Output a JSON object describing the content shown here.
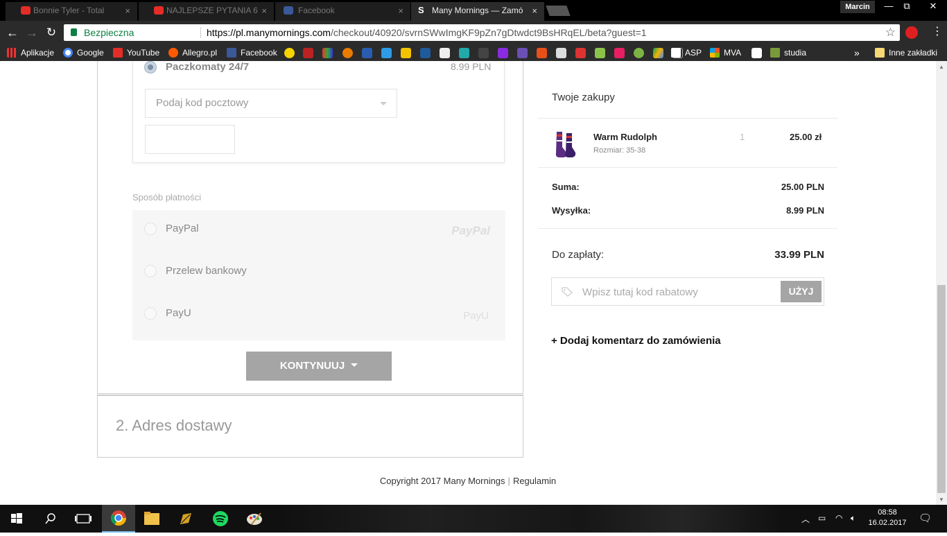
{
  "browser": {
    "tabs": [
      {
        "title": "Bonnie Tyler - Total",
        "close": "×"
      },
      {
        "title": "NAJLEPSZE PYTANIA 6",
        "close": "×"
      },
      {
        "title": "Facebook",
        "close": "×"
      },
      {
        "title": "Many Mornings — Zamó",
        "close": "×"
      }
    ],
    "user": "Marcin",
    "window_controls": {
      "minimize": "—",
      "restore": "⧉",
      "close": "✕"
    },
    "secure_label": "Bezpieczna",
    "url_host": "https://pl.manymornings.com",
    "url_path": "/checkout/40920/svrnSWwImgKF9pZn7gDtwdct9BsHRqEL/beta?guest=1",
    "bookmarks": [
      {
        "label": "Aplikacje",
        "icon": "apps-grid-icon"
      },
      {
        "label": "Google",
        "icon": "google-icon"
      },
      {
        "label": "YouTube",
        "icon": "youtube-icon"
      },
      {
        "label": "Allegro.pl",
        "icon": "allegro-icon"
      },
      {
        "label": "Facebook",
        "icon": "facebook-icon"
      },
      {
        "label": "ASP",
        "icon": "page-icon"
      },
      {
        "label": "MVA",
        "icon": "microsoft-icon"
      },
      {
        "label": "studia",
        "icon": "studia-icon"
      }
    ],
    "bookmarks_overflow": "»",
    "other_bookmarks": "Inne zakładki"
  },
  "shipping": {
    "option_label": "Paczkomaty 24/7",
    "option_price": "8.99 PLN",
    "postcode_placeholder": "Podaj kod pocztowy"
  },
  "payment": {
    "section_label": "Sposób płatności",
    "methods": [
      {
        "label": "PayPal",
        "logo": "PayPal"
      },
      {
        "label": "Przelew bankowy",
        "logo": ""
      },
      {
        "label": "PayU",
        "logo": "PayU"
      }
    ],
    "continue_label": "KONTYNUUJ"
  },
  "address": {
    "number": "2.",
    "title": "Adres dostawy"
  },
  "cart": {
    "title": "Twoje zakupy",
    "items": [
      {
        "name": "Warm Rudolph",
        "size": "Rozmiar: 35-38",
        "qty": "1",
        "price": "25.00 zł"
      }
    ],
    "sum_label": "Suma:",
    "sum_value": "25.00 PLN",
    "shipping_label": "Wysyłka:",
    "shipping_value": "8.99 PLN",
    "total_label": "Do zapłaty:",
    "total_value": "33.99 PLN",
    "coupon_placeholder": "Wpisz tutaj kod rabatowy",
    "coupon_button": "UŻYJ",
    "add_comment": "+ Dodaj komentarz do zamówienia"
  },
  "footer": {
    "copyright": "Copyright 2017 Many Mornings",
    "terms": "Regulamin"
  },
  "taskbar": {
    "time": "08:58",
    "date": "16.02.2017"
  },
  "colors": {
    "accent_secure": "#0b8043",
    "button_gray": "#a5a5a5",
    "taskbar_highlight": "#76b9ed"
  }
}
